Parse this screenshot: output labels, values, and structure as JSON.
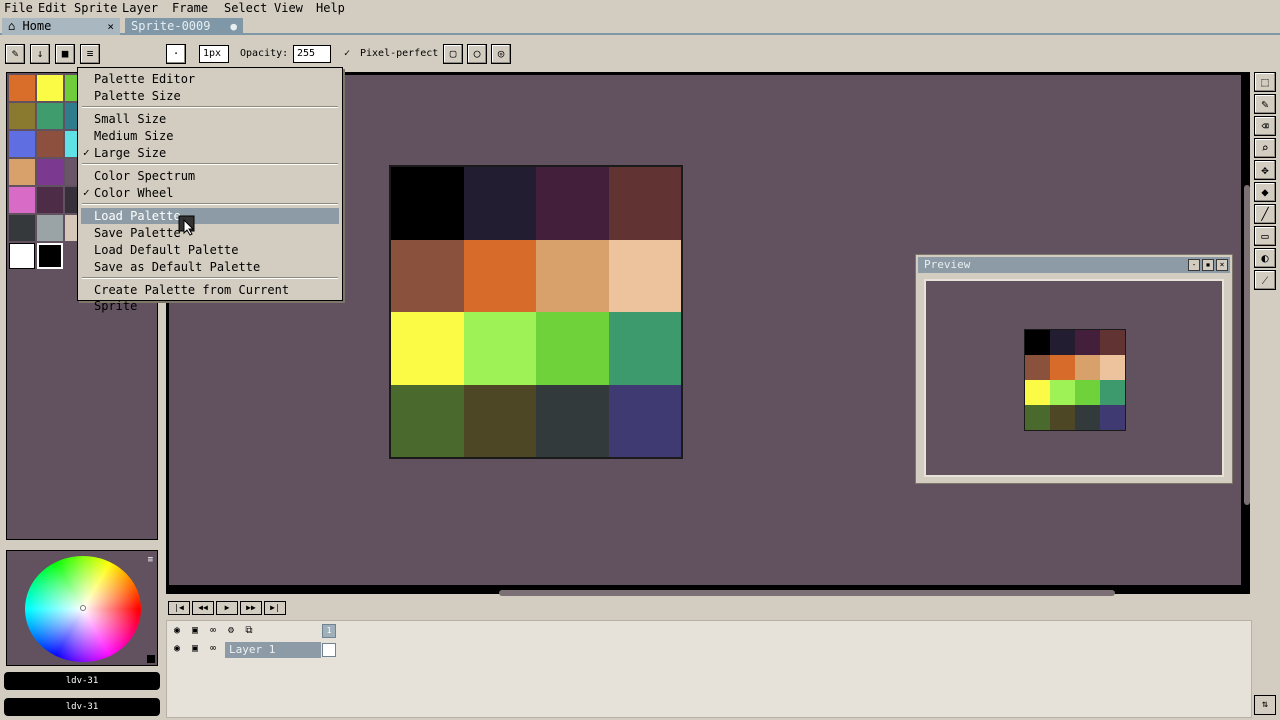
{
  "menubar": {
    "items": [
      "File",
      "Edit",
      "Sprite",
      "Layer",
      "Frame",
      "Select",
      "View",
      "Help"
    ]
  },
  "tabs": [
    {
      "label": "Home",
      "close": "×"
    },
    {
      "label": "Sprite-0009",
      "close": "●"
    }
  ],
  "toolbar": {
    "brush_size": "1px",
    "opacity_label": "Opacity:",
    "opacity_value": "255",
    "pixel_perfect_label": "Pixel-perfect",
    "pixel_perfect_check": "✓"
  },
  "palette": {
    "colors": [
      "#d96e2b",
      "#fbfb45",
      "#6fcd3a",
      "#8a7a30",
      "#3f9c6d",
      "#2f7d8c",
      "#5f6ee0",
      "#8d4f3e",
      "#5fe2e6",
      "#d8a06b",
      "#7b3a8f",
      "#6a5468",
      "#d86bc6",
      "#4d2c48",
      "#35303a",
      "#35393c",
      "#9aa3a6",
      "#d6c7b8"
    ],
    "fg": "#ffffff",
    "bg": "#000000"
  },
  "colorbars": [
    "ldv-31",
    "ldv-31"
  ],
  "sprite": {
    "cells": [
      "#000000",
      "#221d31",
      "#431f3b",
      "#613332",
      "#8a523d",
      "#d76b2a",
      "#d8a06b",
      "#ecc39d",
      "#fbfb45",
      "#9ff255",
      "#70d23a",
      "#3d9a6d",
      "#4a6a2d",
      "#4e4725",
      "#333a3b",
      "#403a72"
    ]
  },
  "preview": {
    "title": "Preview",
    "buttons": [
      "-",
      "▪",
      "×"
    ]
  },
  "timeline": {
    "layer_name": "Layer 1",
    "frame_number": "1"
  },
  "dropdown": {
    "items": [
      {
        "label": "Palette Editor",
        "checked": false
      },
      {
        "label": "Palette Size",
        "checked": false
      },
      {
        "label": "Small Size",
        "checked": false
      },
      {
        "label": "Medium Size",
        "checked": false
      },
      {
        "label": "Large Size",
        "checked": true
      },
      {
        "label": "Color Spectrum",
        "checked": false
      },
      {
        "label": "Color Wheel",
        "checked": true
      },
      {
        "label": "Load Palette",
        "checked": false
      },
      {
        "label": "Save Palette",
        "checked": false
      },
      {
        "label": "Load Default Palette",
        "checked": false
      },
      {
        "label": "Save as Default Palette",
        "checked": false
      },
      {
        "label": "Create Palette from Current Sprite",
        "checked": false
      }
    ],
    "check_glyph": "✓"
  },
  "colors": {
    "canvas_bg": "#625260",
    "ui_bg": "#d3cdc1",
    "highlight": "#8c9ba5"
  }
}
